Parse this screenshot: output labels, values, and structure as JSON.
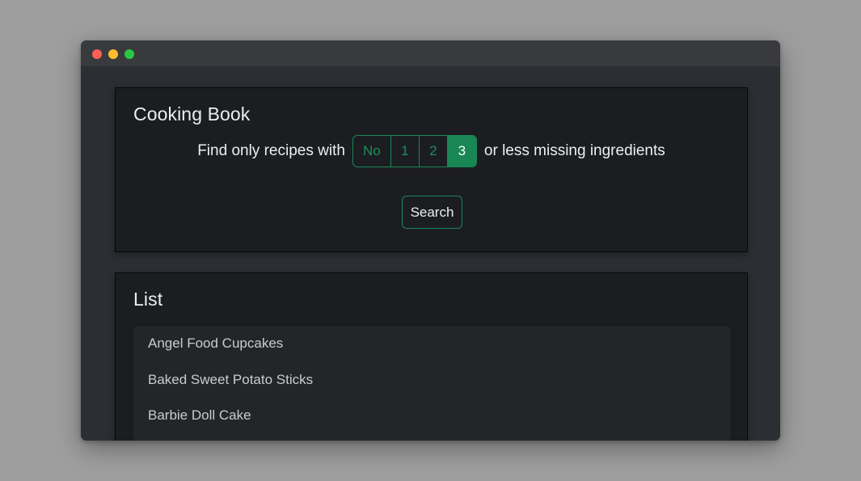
{
  "header": {
    "title": "Cooking Book"
  },
  "filter": {
    "prefix": "Find only recipes with",
    "suffix": "or less missing ingredients",
    "options": [
      "No",
      "1",
      "2",
      "3"
    ],
    "selected": "3"
  },
  "search": {
    "label": "Search"
  },
  "list": {
    "title": "List",
    "items": [
      "Angel Food Cupcakes",
      "Baked Sweet Potato Sticks",
      "Barbie Doll Cake"
    ]
  },
  "colors": {
    "accent": "#198754",
    "card_bg": "#1b1d21",
    "page_bg": "#2b2e32"
  }
}
